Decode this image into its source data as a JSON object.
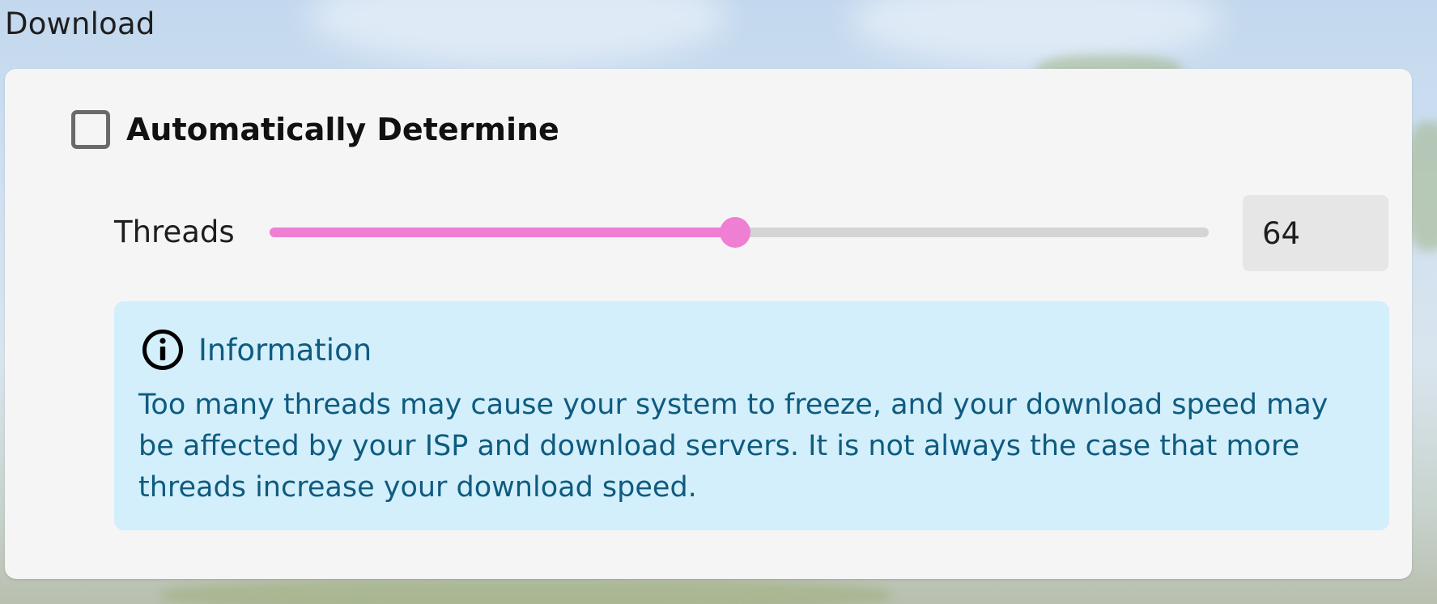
{
  "section": {
    "title": "Download"
  },
  "auto": {
    "label": "Automatically Determine",
    "checked": false
  },
  "threads": {
    "label": "Threads",
    "value": "64",
    "slider_fraction": 0.496
  },
  "info": {
    "icon": "info-icon",
    "title": "Information",
    "text": "Too many threads may cause your system to freeze, and your download speed may be affected by your ISP and download servers. It is not always the case that more threads increase your download speed."
  },
  "colors": {
    "accent": "#ef7fd3",
    "track": "#d4d4d4",
    "info_bg": "#d3effb",
    "info_text": "#0f5b7f",
    "card_bg": "#f5f5f5"
  }
}
